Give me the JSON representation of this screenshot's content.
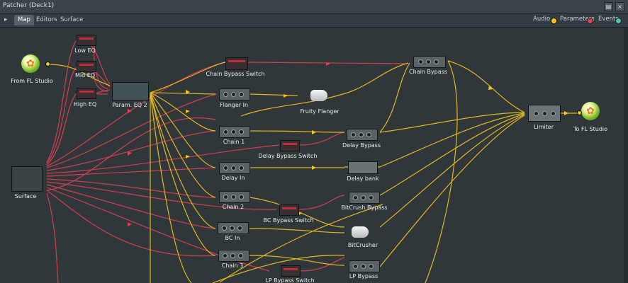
{
  "window": {
    "title": "Patcher (Deck1)",
    "buttons": {
      "menu": "▤",
      "close": "×"
    }
  },
  "tabbar": {
    "arrow": "▸",
    "tabs": [
      {
        "label": "Map",
        "active": true
      },
      {
        "label": "Editors",
        "active": false
      },
      {
        "label": "Surface",
        "active": false
      }
    ],
    "legend": {
      "audio": "Audio",
      "parameters": "Parameters",
      "events": "Events"
    }
  },
  "colors": {
    "audio": "#f3c61b",
    "parameters": "#e0404f",
    "events": "#4ec7a4"
  },
  "nodes": {
    "from_fl": {
      "label": "From FL Studio",
      "icon": "fl-studio-icon"
    },
    "low_eq": {
      "label": "Low EQ"
    },
    "mid_eq": {
      "label": "Mid EQ"
    },
    "high_eq": {
      "label": "High EQ"
    },
    "param_eq": {
      "label": "Param. EQ 2"
    },
    "surface": {
      "label": "Surface"
    },
    "chain_bypass_switch": {
      "label": "Chain Bypass Switch"
    },
    "chain_bypass": {
      "label": "Chain Bypass"
    },
    "flanger_in": {
      "label": "Flanger In"
    },
    "fruity_flanger": {
      "label": "Fruity Flanger",
      "icon": "plugin-bulb-icon"
    },
    "chain1": {
      "label": "Chain 1"
    },
    "delay_bypass_switch": {
      "label": "Delay Bypass Switch"
    },
    "delay_bypass": {
      "label": "Delay Bypass"
    },
    "delay_in": {
      "label": "Delay In"
    },
    "delay_bank": {
      "label": "Delay bank"
    },
    "chain2": {
      "label": "Chain 2"
    },
    "bitcrush_bypass": {
      "label": "BitCrush Bypass"
    },
    "bc_bypass_switch": {
      "label": "BC Bypass Switch"
    },
    "bc_in": {
      "label": "BC In"
    },
    "bitcrusher": {
      "label": "BitCrusher",
      "icon": "plugin-bulb-icon"
    },
    "chain3": {
      "label": "Chain 3"
    },
    "lp_bypass": {
      "label": "LP Bypass"
    },
    "lp_bypass_switch": {
      "label": "LP Bypass Switch"
    },
    "limiter": {
      "label": "Limiter"
    },
    "to_fl": {
      "label": "To FL Studio",
      "icon": "fl-studio-icon"
    }
  }
}
